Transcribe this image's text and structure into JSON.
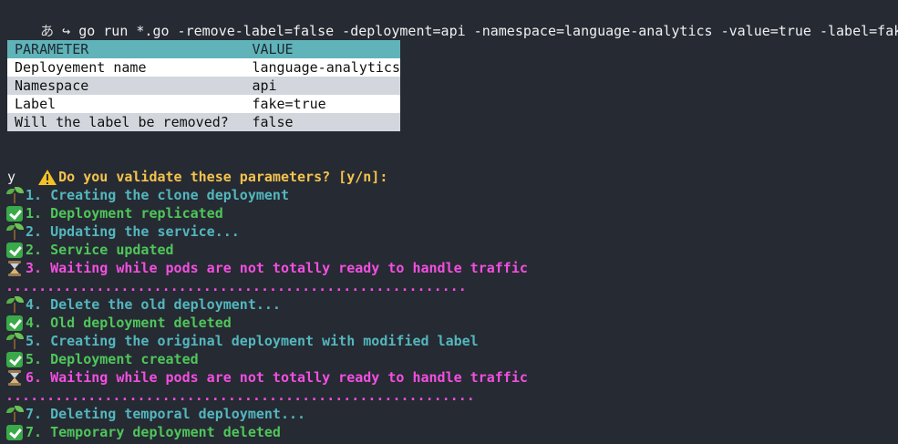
{
  "terminal": {
    "prompt_glyph": "あ",
    "prompt_arrow": "↪",
    "command": "go run *.go -remove-label=false -deployment=api -namespace=language-analytics -value=true -label=fake"
  },
  "table": {
    "headers": [
      "PARAMETER",
      "VALUE"
    ],
    "rows": [
      {
        "param": "Deployement name",
        "value": "language-analytics"
      },
      {
        "param": "Namespace",
        "value": "api"
      },
      {
        "param": "Label",
        "value": "fake=true"
      },
      {
        "param": "Will the label be removed?",
        "value": "false"
      }
    ]
  },
  "prompt": {
    "question": "Do you validate these parameters? [y/n]:",
    "answer": "y"
  },
  "steps": [
    {
      "icon": "sprout-icon",
      "text": "1. Creating the clone deployment",
      "style": "cyan"
    },
    {
      "icon": "check-icon",
      "text": "1. Deployment replicated",
      "style": "green"
    },
    {
      "icon": "sprout-icon",
      "text": "2. Updating the service...",
      "style": "cyan"
    },
    {
      "icon": "check-icon",
      "text": "2. Service updated",
      "style": "green"
    },
    {
      "icon": "hourglass-icon",
      "text": "3. Waiting while pods are not totally ready to handle traffic",
      "style": "magenta"
    },
    {
      "icon": "",
      "text": "........................................................",
      "style": "dots"
    },
    {
      "icon": "sprout-icon",
      "text": "4. Delete the old deployment...",
      "style": "cyan"
    },
    {
      "icon": "check-icon",
      "text": "4. Old deployment deleted",
      "style": "green"
    },
    {
      "icon": "sprout-icon",
      "text": "5. Creating the original deployment with modified label",
      "style": "cyan"
    },
    {
      "icon": "check-icon",
      "text": "5. Deployment created",
      "style": "green"
    },
    {
      "icon": "hourglass-icon",
      "text": "6. Waiting while pods are not totally ready to handle traffic",
      "style": "magenta"
    },
    {
      "icon": "",
      "text": ".........................................................",
      "style": "dots"
    },
    {
      "icon": "sprout-icon",
      "text": "7. Deleting temporal deployment...",
      "style": "cyan"
    },
    {
      "icon": "check-icon",
      "text": "7. Temporary deployment deleted",
      "style": "green"
    }
  ],
  "colors": {
    "background": "#262a33",
    "table_header": "#5fb3b9",
    "cyan": "#53b7bd",
    "green": "#4fc65a",
    "magenta": "#f24fe0",
    "warning": "#f4c34d"
  }
}
